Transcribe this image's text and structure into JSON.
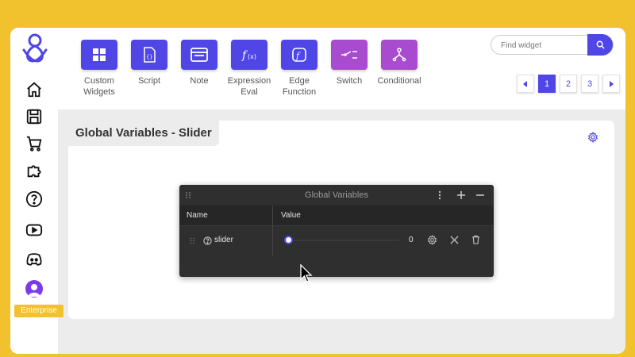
{
  "sidebar": {
    "items": [
      {
        "icon": "home-icon"
      },
      {
        "icon": "save-icon"
      },
      {
        "icon": "cart-icon"
      },
      {
        "icon": "puzzle-icon"
      },
      {
        "icon": "help-icon"
      },
      {
        "icon": "youtube-icon"
      },
      {
        "icon": "discord-icon"
      }
    ],
    "badge": "Enterprise"
  },
  "toolbar": {
    "tools": [
      {
        "label": "Custom Widgets",
        "icon": "widgets-grid-icon",
        "color": "#4F46E5"
      },
      {
        "label": "Script",
        "icon": "script-icon",
        "color": "#4F46E5"
      },
      {
        "label": "Note",
        "icon": "note-icon",
        "color": "#4F46E5"
      },
      {
        "label": "Expression Eval",
        "icon": "function-icon",
        "color": "#4F46E5"
      },
      {
        "label": "Edge Function",
        "icon": "edge-function-icon",
        "color": "#4F46E5"
      },
      {
        "label": "Switch",
        "icon": "switch-icon",
        "color": "#A84BCF"
      },
      {
        "label": "Conditional",
        "icon": "conditional-icon",
        "color": "#A84BCF"
      }
    ]
  },
  "search": {
    "placeholder": "Find widget"
  },
  "pagination": {
    "pages": [
      "1",
      "2",
      "3"
    ],
    "current": "1"
  },
  "panel": {
    "title": "Global Variables - Slider"
  },
  "global_variables": {
    "title": "Global Variables",
    "columns": {
      "name": "Name",
      "value": "Value"
    },
    "rows": [
      {
        "name": "slider",
        "value": "0"
      }
    ]
  },
  "colors": {
    "accent": "#4F46E5",
    "secondary": "#A84BCF",
    "background": "#F2C12E"
  }
}
